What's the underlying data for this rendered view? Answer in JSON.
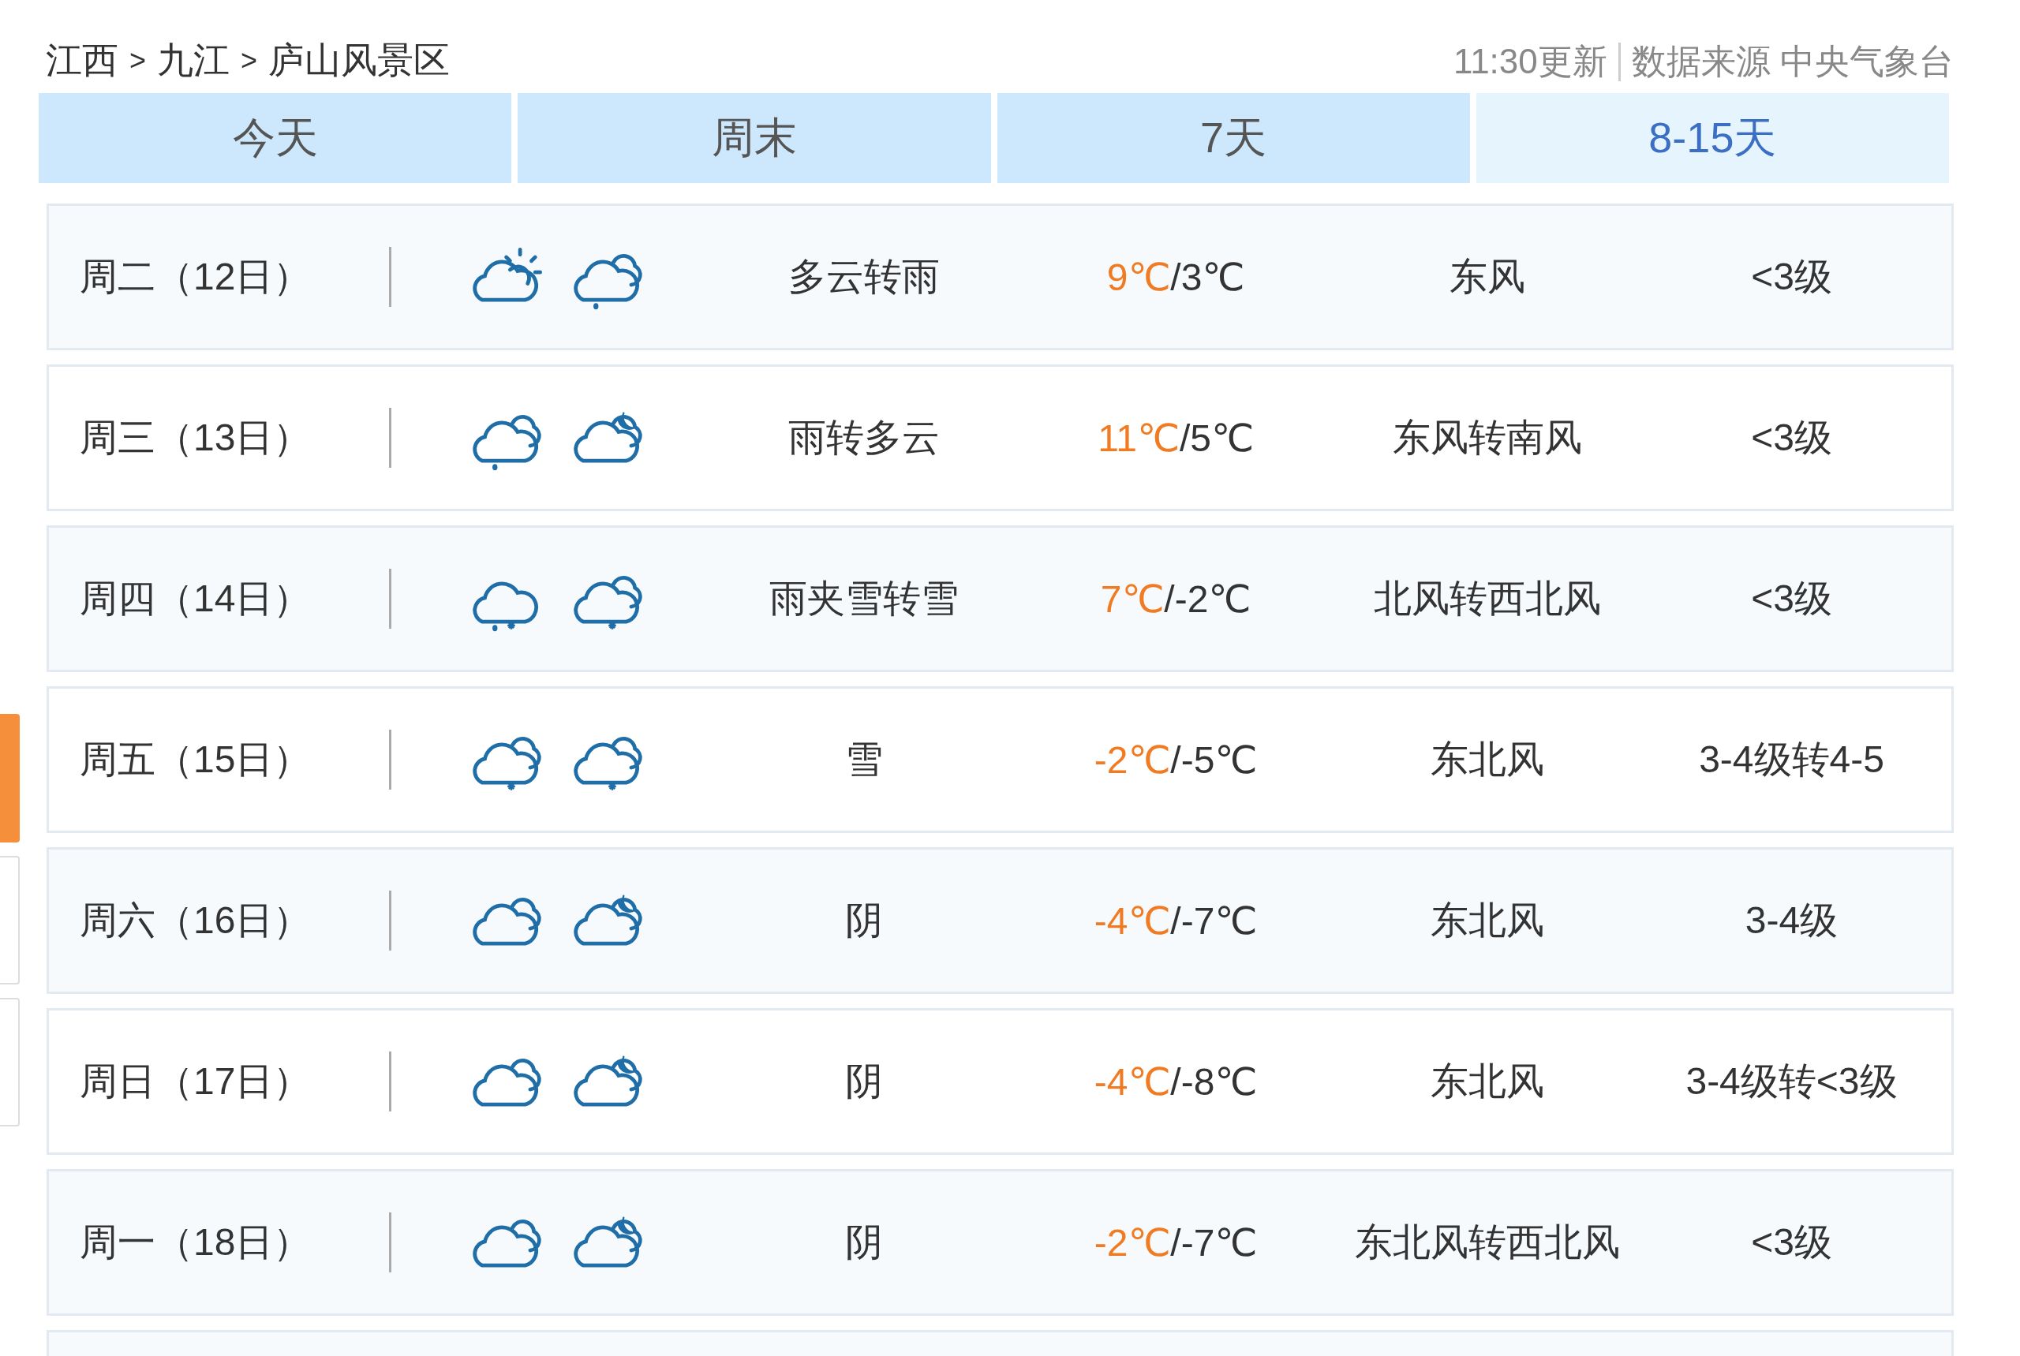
{
  "breadcrumb": {
    "items": [
      "江西",
      "九江",
      "庐山风景区"
    ],
    "separator": ">"
  },
  "update_time": "11:30更新",
  "source": "数据来源 中央气象台",
  "tabs": [
    {
      "label": "今天",
      "selected": false
    },
    {
      "label": "周末",
      "selected": false
    },
    {
      "label": "7天",
      "selected": false
    },
    {
      "label": "8-15天",
      "selected": true
    }
  ],
  "forecast": [
    {
      "date": "周二（12日）",
      "icons": [
        {
          "kind": "cloudy-sun"
        },
        {
          "kind": "rain"
        }
      ],
      "weather": "多云转雨",
      "high": "9℃",
      "low": "/3℃",
      "wind": "东风",
      "level": "<3级"
    },
    {
      "date": "周三（13日）",
      "icons": [
        {
          "kind": "rain"
        },
        {
          "kind": "cloudy-moon"
        }
      ],
      "weather": "雨转多云",
      "high": "11℃",
      "low": "/5℃",
      "wind": "东风转南风",
      "level": "<3级"
    },
    {
      "date": "周四（14日）",
      "icons": [
        {
          "kind": "sleet"
        },
        {
          "kind": "snow"
        }
      ],
      "weather": "雨夹雪转雪",
      "high": "7℃",
      "low": "/-2℃",
      "wind": "北风转西北风",
      "level": "<3级"
    },
    {
      "date": "周五（15日）",
      "icons": [
        {
          "kind": "snow"
        },
        {
          "kind": "snow"
        }
      ],
      "weather": "雪",
      "high": "-2℃",
      "low": "/-5℃",
      "wind": "东北风",
      "level": "3-4级转4-5"
    },
    {
      "date": "周六（16日）",
      "icons": [
        {
          "kind": "overcast"
        },
        {
          "kind": "cloudy-moon"
        }
      ],
      "weather": "阴",
      "high": "-4℃",
      "low": "/-7℃",
      "wind": "东北风",
      "level": "3-4级"
    },
    {
      "date": "周日（17日）",
      "icons": [
        {
          "kind": "overcast"
        },
        {
          "kind": "cloudy-moon"
        }
      ],
      "weather": "阴",
      "high": "-4℃",
      "low": "/-8℃",
      "wind": "东北风",
      "level": "3-4级转<3级"
    },
    {
      "date": "周一（18日）",
      "icons": [
        {
          "kind": "overcast"
        },
        {
          "kind": "cloudy-moon"
        }
      ],
      "weather": "阴",
      "high": "-2℃",
      "low": "/-7℃",
      "wind": "东北风转西北风",
      "level": "<3级"
    }
  ]
}
